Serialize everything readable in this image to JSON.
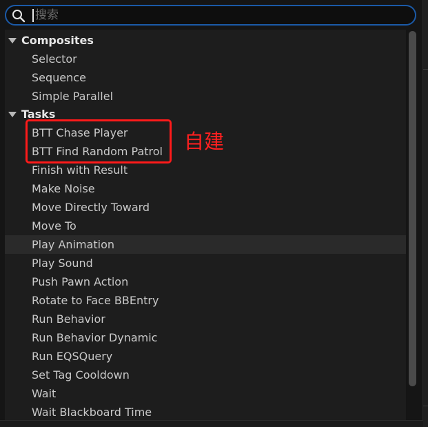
{
  "search": {
    "placeholder": "搜索",
    "value": ""
  },
  "categories": [
    {
      "label": "Composites",
      "items": [
        "Selector",
        "Sequence",
        "Simple Parallel"
      ]
    },
    {
      "label": "Tasks",
      "items": [
        "BTT Chase Player",
        "BTT Find Random Patrol",
        "Finish with Result",
        "Make Noise",
        "Move Directly Toward",
        "Move To",
        "Play Animation",
        "Play Sound",
        "Push Pawn Action",
        "Rotate to Face BBEntry",
        "Run Behavior",
        "Run Behavior Dynamic",
        "Run EQSQuery",
        "Set Tag Cooldown",
        "Wait",
        "Wait Blackboard Time"
      ]
    }
  ],
  "highlighted_item": "Play Animation",
  "annotation": {
    "text": "自建",
    "color": "#ff1a1a"
  },
  "colors": {
    "accent": "#1b5aa8",
    "highlight_row": "#2a2a2a",
    "annotation": "#ff1a1a"
  }
}
